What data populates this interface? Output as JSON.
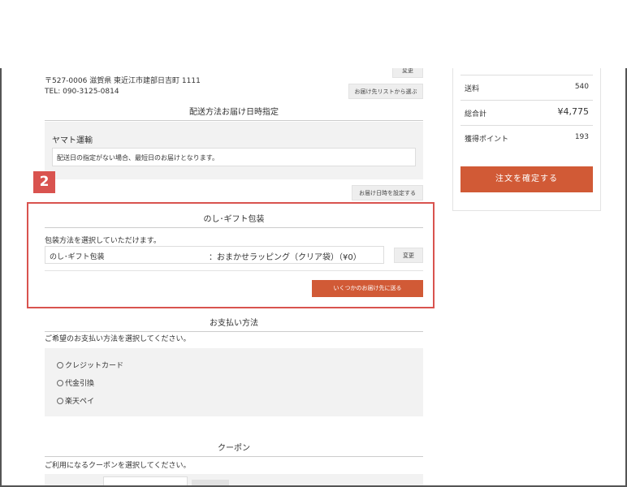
{
  "address": {
    "postal_line": "〒527-0006 滋賀県 東近江市建部日吉町 1111",
    "tel_line": "TEL: 090-3125-0814",
    "change_button": "変更",
    "address_list_button": "お届け先リストから選ぶ"
  },
  "delivery": {
    "title": "配送方法お届け日時指定",
    "carrier": "ヤマト運輸",
    "note": "配送日の指定がない場合、最短日のお届けとなります。",
    "set_datetime_button": "お届け日時を設定する"
  },
  "callout": {
    "number": "2",
    "color": "#d9534f"
  },
  "gift": {
    "title": "のし･ギフト包装",
    "description": "包装方法を選択していただけます。",
    "label": "のし･ギフト包装",
    "value": "：おまかせラッピング（クリア袋）（¥0）",
    "change_button": "変更",
    "multi_address_button": "いくつかのお届け先に送る"
  },
  "payment": {
    "title": "お支払い方法",
    "description": "ご希望のお支払い方法を選択してください。",
    "options": [
      "クレジットカード",
      "代金引換",
      "楽天ペイ"
    ]
  },
  "coupon": {
    "title": "クーポン",
    "description": "ご利用になるクーポンを選択してください。"
  },
  "summary": {
    "shipping_label": "送料",
    "shipping_value": "540",
    "total_label": "総合計",
    "total_value": "¥4,775",
    "points_label": "獲得ポイント",
    "points_value": "193",
    "confirm_button": "注文を確定する"
  },
  "colors": {
    "accent": "#d15a36",
    "highlight": "#d9534f",
    "panel_gray": "#f2f2f2"
  }
}
